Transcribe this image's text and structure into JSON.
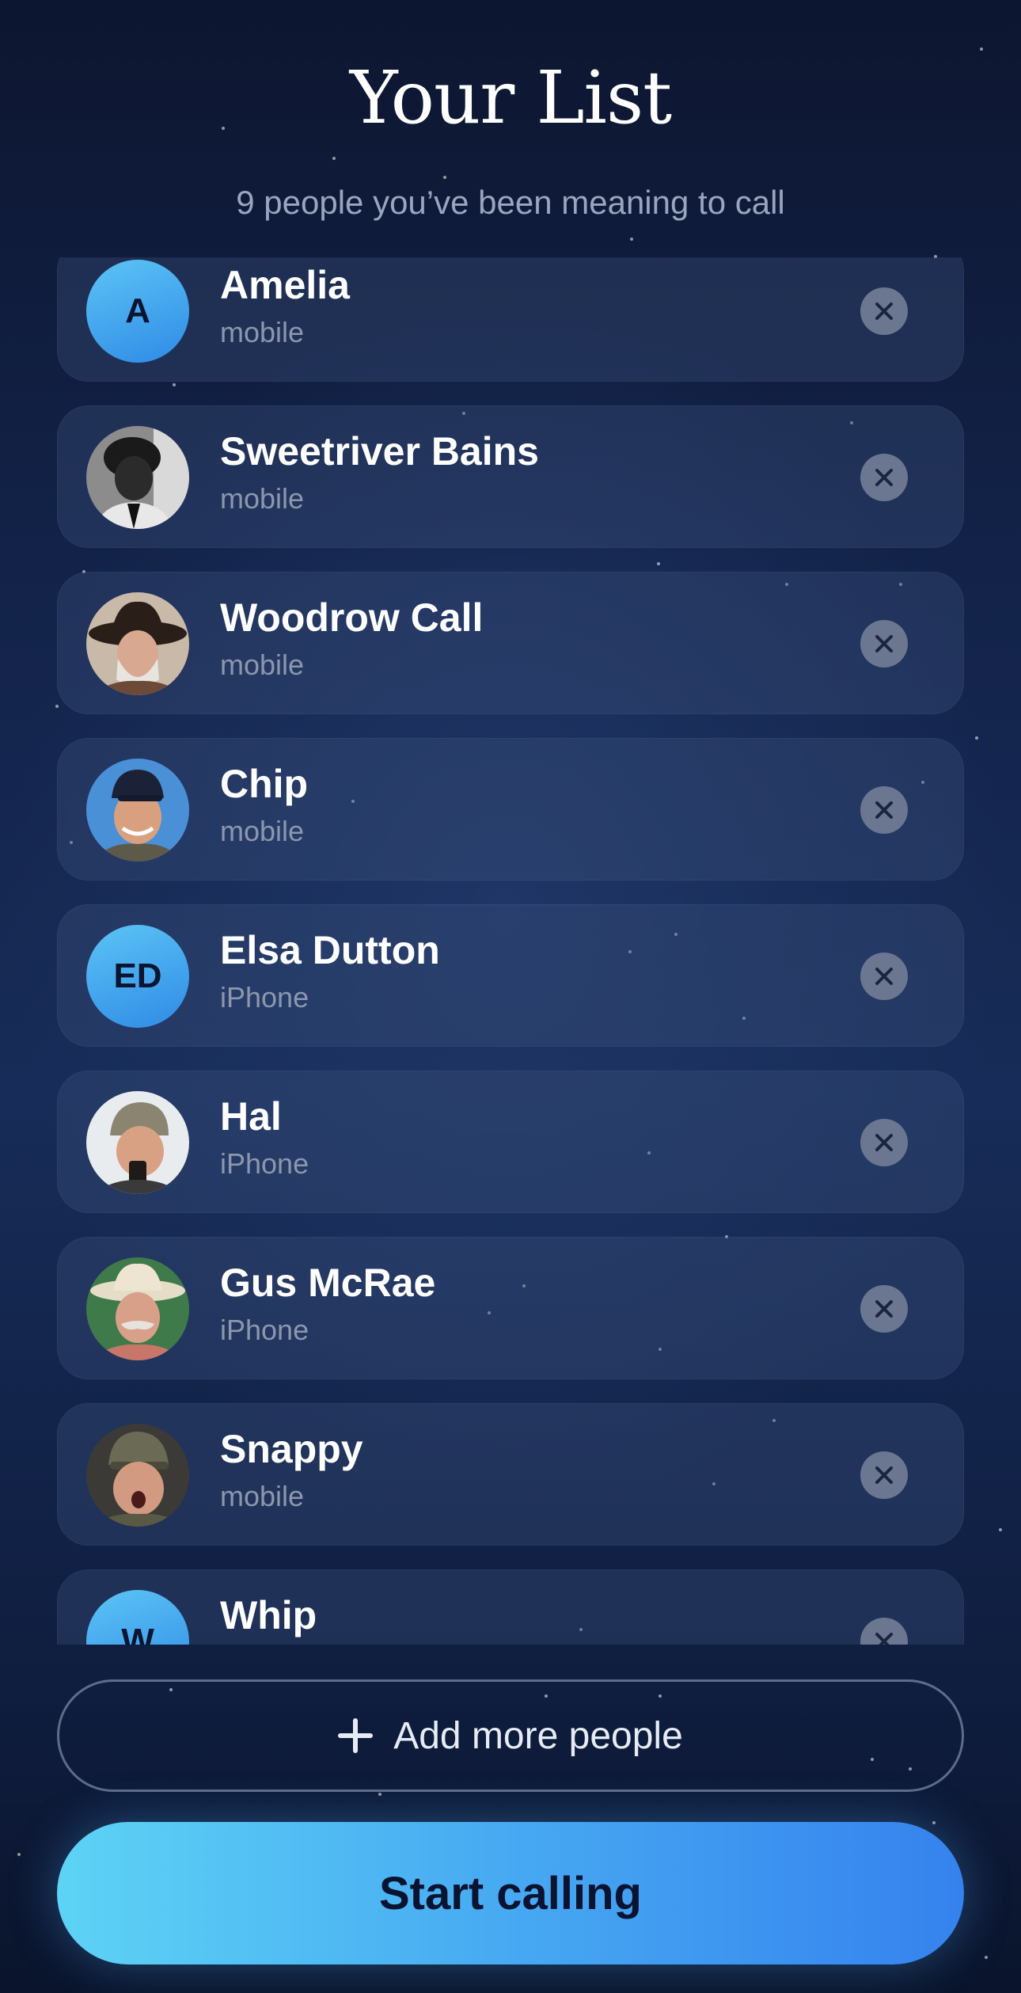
{
  "header": {
    "title": "Your List",
    "subtitle": "9 people you’ve been meaning to call"
  },
  "contacts": [
    {
      "name": "Amelia",
      "label": "mobile",
      "avatar": {
        "type": "initials",
        "text": "A"
      }
    },
    {
      "name": "Sweetriver Bains",
      "label": "mobile",
      "avatar": {
        "type": "photo"
      }
    },
    {
      "name": "Woodrow Call",
      "label": "mobile",
      "avatar": {
        "type": "photo"
      }
    },
    {
      "name": "Chip",
      "label": "mobile",
      "avatar": {
        "type": "photo"
      }
    },
    {
      "name": "Elsa Dutton",
      "label": "iPhone",
      "avatar": {
        "type": "initials",
        "text": "ED"
      }
    },
    {
      "name": "Hal",
      "label": "iPhone",
      "avatar": {
        "type": "photo"
      }
    },
    {
      "name": "Gus McRae",
      "label": "iPhone",
      "avatar": {
        "type": "photo"
      }
    },
    {
      "name": "Snappy",
      "label": "mobile",
      "avatar": {
        "type": "photo"
      }
    },
    {
      "name": "Whip",
      "label": "",
      "avatar": {
        "type": "initials",
        "text": "W"
      }
    }
  ],
  "actions": {
    "add_label": "Add more people",
    "start_label": "Start calling"
  },
  "icons": {
    "remove": "close-icon",
    "add": "plus-icon"
  },
  "colors": {
    "accent_start": "#5dd3f5",
    "accent_end": "#3582ee",
    "background": "#13234a",
    "remove_button": "#6b7791"
  }
}
